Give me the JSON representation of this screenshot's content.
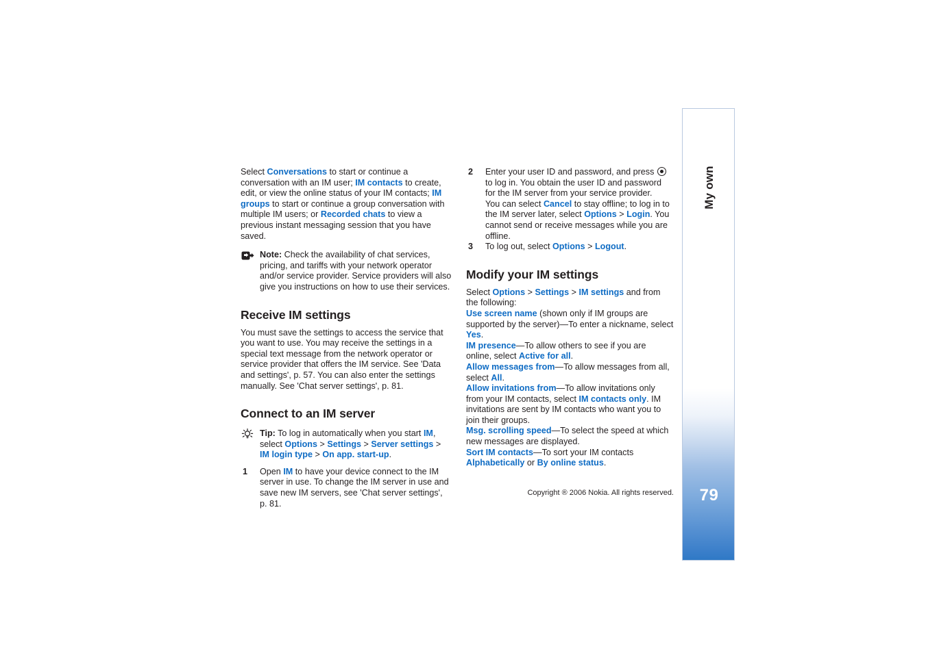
{
  "page": {
    "number": "79",
    "tab_label": "My own",
    "copyright": "Copyright ® 2006 Nokia. All rights reserved."
  },
  "left_column": {
    "intro": {
      "t1": "Select ",
      "l1": "Conversations",
      "t2": " to start or continue a conversation with an IM user; ",
      "l2": "IM contacts",
      "t3": " to create, edit, or view the online status of your IM contacts; ",
      "l3": "IM groups",
      "t4": " to start or continue a group conversation with multiple IM users; or ",
      "l4": "Recorded chats",
      "t5": " to view a previous instant messaging session that you have saved."
    },
    "note": {
      "icon": "note-icon",
      "label": "Note:",
      "text": " Check the availability of chat services, pricing, and tariffs with your network operator and/or service provider. Service providers will also give you instructions on how to use their services."
    },
    "heading_receive": "Receive IM settings",
    "receive_body": "You must save the settings to access the service that you want to use. You may receive the settings in a special text message from the network operator or service provider that offers the IM service. See 'Data and settings', p. 57. You can also enter the settings manually. See 'Chat server settings', p. 81.",
    "heading_connect": "Connect to an IM server",
    "tip": {
      "icon": "tip-icon",
      "label": "Tip:",
      "t1": " To log in automatically when you start ",
      "l1": "IM",
      "t2": ", select ",
      "l2": "Options",
      "sep1": " > ",
      "l3": "Settings",
      "sep2": " > ",
      "l4": "Server settings",
      "sep3": " > ",
      "l5": "IM login type",
      "sep4": " > ",
      "l6": "On app. start-up",
      "t3": "."
    },
    "step1": {
      "num": "1",
      "t1": "Open ",
      "l1": "IM",
      "t2": " to have your device connect to the IM server in use. To change the IM server in use and save new IM servers, see 'Chat server settings', p. 81."
    }
  },
  "right_column": {
    "step2": {
      "num": "2",
      "t1": "Enter your user ID and password, and press ",
      "icon": "scroll-key-icon",
      "t2": " to log in. You obtain the user ID and password for the IM server from your service provider.",
      "t3": "You can select ",
      "l1": "Cancel",
      "t4": " to stay offline; to log in to the IM server later, select ",
      "l2": "Options",
      "sep1": " > ",
      "l3": "Login",
      "t5": ". You cannot send or receive messages while you are offline."
    },
    "step3": {
      "num": "3",
      "t1": "To log out, select ",
      "l1": "Options",
      "sep1": " > ",
      "l2": "Logout",
      "t2": "."
    },
    "heading_modify": "Modify your IM settings",
    "modify_intro": {
      "t1": "Select ",
      "l1": "Options",
      "sep1": " > ",
      "l2": "Settings",
      "sep2": " > ",
      "l3": "IM settings",
      "t2": " and from the following:"
    },
    "settings": [
      {
        "name": "Use screen name",
        "t1": " (shown only if IM groups are supported by the server)—To enter a nickname, select ",
        "value": "Yes",
        "t2": "."
      },
      {
        "name": "IM presence",
        "t1": "—To allow others to see if you are online, select ",
        "value": "Active for all",
        "t2": "."
      },
      {
        "name": "Allow messages from",
        "t1": "—To allow messages from all, select ",
        "value": "All",
        "t2": "."
      },
      {
        "name": "Allow invitations from",
        "t1": "—To allow invitations only from your IM contacts, select ",
        "value": "IM contacts only",
        "t2": ". IM invitations are sent by IM contacts who want you to join their groups."
      },
      {
        "name": "Msg. scrolling speed",
        "t1": "—To select the speed at which new messages are displayed.",
        "value": "",
        "t2": ""
      },
      {
        "name": "Sort IM contacts",
        "t1": "—To sort your IM contacts ",
        "value": "Alphabetically",
        "t2": " or ",
        "value2": "By online status",
        "t3": "."
      }
    ]
  },
  "colors": {
    "link": "#0f6cc4",
    "text": "#231f20",
    "tab_blue": "#2f79c6",
    "tab_border": "#b9c9e0"
  }
}
